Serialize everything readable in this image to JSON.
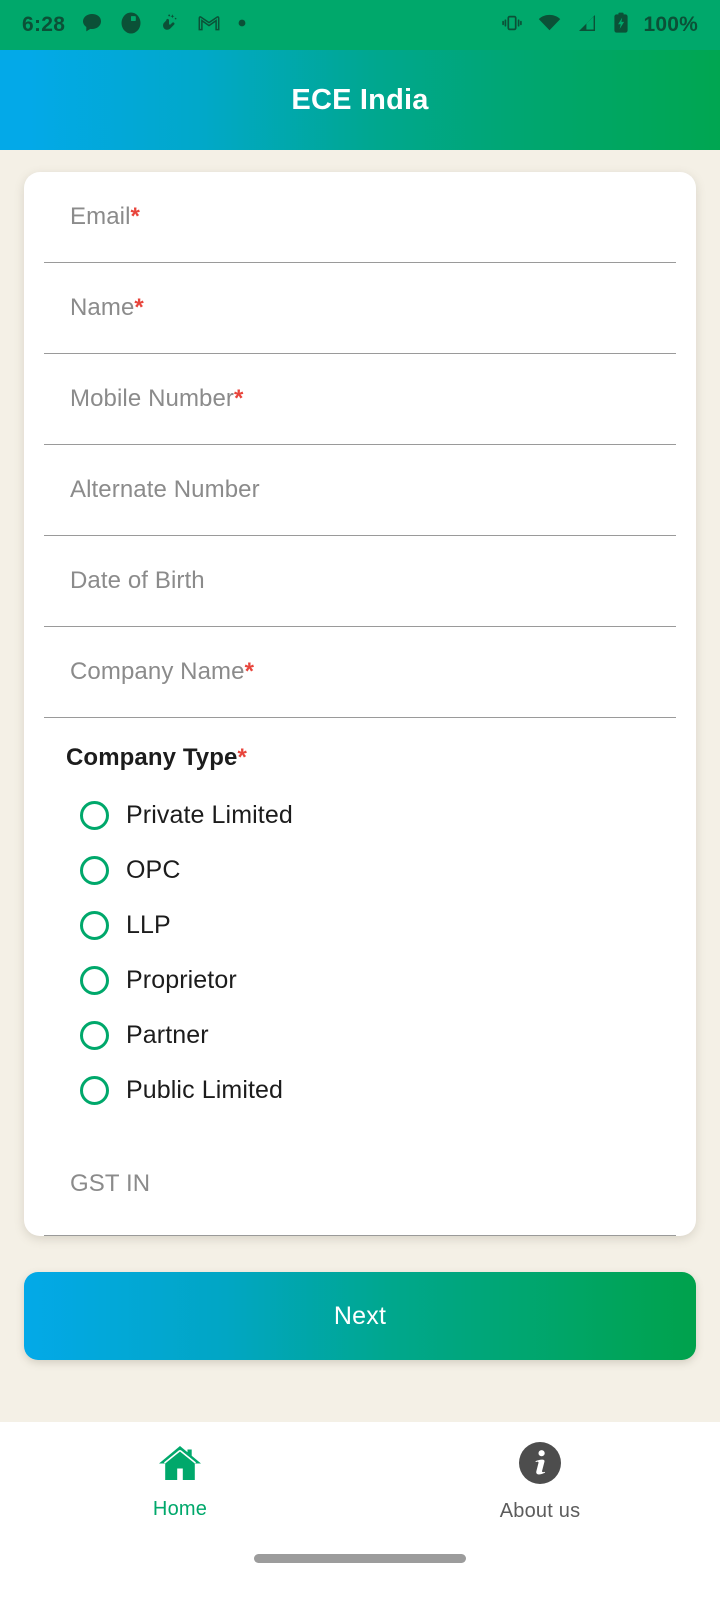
{
  "status_bar": {
    "time": "6:28",
    "battery_percent": "100%",
    "left_icons": [
      "chat-bubble-icon",
      "contrast-circle-icon",
      "hand-sparkle-icon",
      "gmail-icon",
      "dot-icon"
    ],
    "right_icons": [
      "vibrate-icon",
      "wifi-icon",
      "cellular-signal-icon",
      "battery-charging-icon"
    ],
    "background_color": "#00A86B"
  },
  "app_bar": {
    "title": "ECE India",
    "gradient_from": "#03A9E8",
    "gradient_to": "#00A651"
  },
  "theme": {
    "page_background": "#F4F0E6",
    "card_background": "#FFFFFF",
    "accent_green": "#00A86B",
    "accent_blue": "#03A9E8",
    "required_asterisk_color": "#E8453C",
    "placeholder_color": "#8B8B8B",
    "divider_color": "#9A9A9A"
  },
  "form": {
    "fields": [
      {
        "name": "email",
        "label": "Email",
        "required": true,
        "value": "",
        "placeholder": "Email"
      },
      {
        "name": "name",
        "label": "Name",
        "required": true,
        "value": "",
        "placeholder": "Name"
      },
      {
        "name": "mobile-number",
        "label": "Mobile Number",
        "required": true,
        "value": "",
        "placeholder": "Mobile Number"
      },
      {
        "name": "alternate-number",
        "label": "Alternate Number",
        "required": false,
        "value": "",
        "placeholder": "Alternate Number"
      },
      {
        "name": "date-of-birth",
        "label": "Date of Birth",
        "required": false,
        "value": "",
        "placeholder": "Date of Birth"
      },
      {
        "name": "company-name",
        "label": "Company Name",
        "required": true,
        "value": "",
        "placeholder": "Company Name"
      }
    ],
    "company_type": {
      "label": "Company Type",
      "required": true,
      "selected": null,
      "options": [
        {
          "label": "Private Limited",
          "selected": false
        },
        {
          "label": "OPC",
          "selected": false
        },
        {
          "label": "LLP",
          "selected": false
        },
        {
          "label": "Proprietor",
          "selected": false
        },
        {
          "label": "Partner",
          "selected": false
        },
        {
          "label": "Public Limited",
          "selected": false
        }
      ]
    },
    "gst": {
      "name": "gst-in",
      "label": "GST IN",
      "required": false,
      "value": "",
      "placeholder": "GST IN"
    },
    "submit_label": "Next"
  },
  "bottom_nav": {
    "items": [
      {
        "label": "Home",
        "icon": "home-icon",
        "active": true
      },
      {
        "label": "About us",
        "icon": "info-circle-icon",
        "active": false
      }
    ]
  },
  "asterisk": "*"
}
